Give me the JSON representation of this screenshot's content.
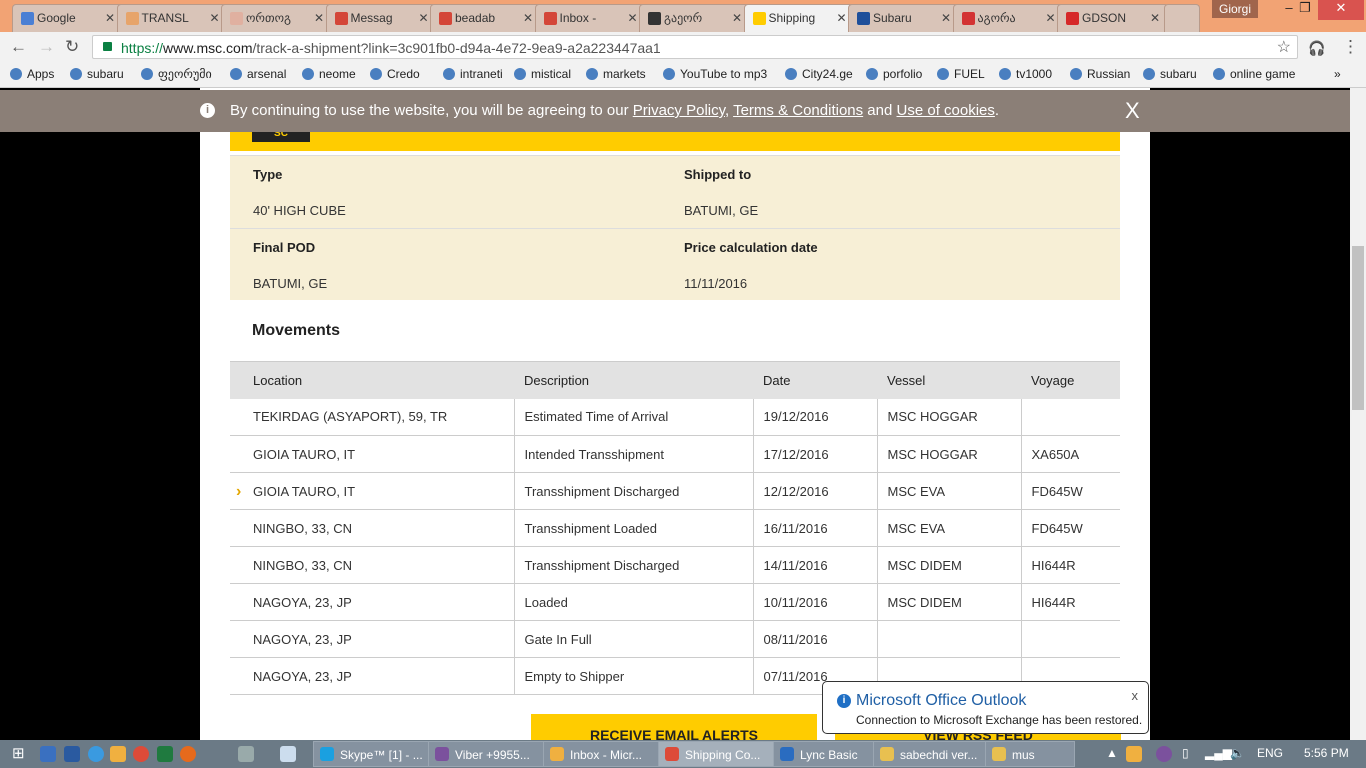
{
  "browser": {
    "tabs": [
      {
        "title": "Google",
        "color": "#4a7fd4"
      },
      {
        "title": "TRANSL",
        "color": "#e7a46a"
      },
      {
        "title": "ორთოგ",
        "color": "#e0b0a0"
      },
      {
        "title": "Messag",
        "color": "#d44638"
      },
      {
        "title": "beadab",
        "color": "#d44638"
      },
      {
        "title": "Inbox -",
        "color": "#d44638"
      },
      {
        "title": "გაეორ",
        "color": "#333333"
      },
      {
        "title": "Shipping",
        "color": "#ffcc00"
      },
      {
        "title": "Subaru",
        "color": "#1f4f9a"
      },
      {
        "title": "აგორა",
        "color": "#d33333"
      },
      {
        "title": "GDSON",
        "color": "#d62828"
      }
    ],
    "close_glyph": "✕",
    "user": "Giorgi",
    "url_prefix": "https://",
    "url_host": "www.msc.com",
    "url_path": "/track-a-shipment?link=3c901fb0-d94a-4e72-9ea9-a2a223447aa1",
    "bookmarks": [
      "Apps",
      "subaru",
      "ფეორუმი",
      "arsenal",
      "neome",
      "Credo",
      "intraneti",
      "mistical",
      "markets",
      "YouTube to mp3",
      "City24.ge",
      "porfolio",
      "FUEL",
      "tv1000",
      "Russian",
      "subaru",
      "online game"
    ],
    "more": "»"
  },
  "cookie": {
    "text": "By continuing to use the website, you will be agreeing to our ",
    "privacy": "Privacy Policy",
    "comma": ", ",
    "terms": "Terms & Conditions",
    "and": " and ",
    "cookies": "Use of cookies",
    "dot": ".",
    "close": "X"
  },
  "logo_text": "SC",
  "details": {
    "type_label": "Type",
    "type_value": "40' HIGH CUBE",
    "shipped_label": "Shipped to",
    "shipped_value": "BATUMI, GE",
    "pod_label": "Final POD",
    "pod_value": "BATUMI, GE",
    "price_label": "Price calculation date",
    "price_value": "11/11/2016"
  },
  "movements": {
    "title": "Movements",
    "columns": [
      "Location",
      "Description",
      "Date",
      "Vessel",
      "Voyage"
    ],
    "rows": [
      [
        "TEKIRDAG (ASYAPORT), 59, TR",
        "Estimated Time of Arrival",
        "19/12/2016",
        "MSC HOGGAR",
        ""
      ],
      [
        "GIOIA TAURO, IT",
        "Intended Transshipment",
        "17/12/2016",
        "MSC HOGGAR",
        "XA650A"
      ],
      [
        "GIOIA TAURO, IT",
        "Transshipment Discharged",
        "12/12/2016",
        "MSC EVA",
        "FD645W"
      ],
      [
        "NINGBO, 33, CN",
        "Transshipment Loaded",
        "16/11/2016",
        "MSC EVA",
        "FD645W"
      ],
      [
        "NINGBO, 33, CN",
        "Transshipment Discharged",
        "14/11/2016",
        "MSC DIDEM",
        "HI644R"
      ],
      [
        "NAGOYA, 23, JP",
        "Loaded",
        "10/11/2016",
        "MSC DIDEM",
        "HI644R"
      ],
      [
        "NAGOYA, 23, JP",
        "Gate In Full",
        "08/11/2016",
        "",
        ""
      ],
      [
        "NAGOYA, 23, JP",
        "Empty to Shipper",
        "07/11/2016",
        "",
        ""
      ]
    ],
    "current_row": 2
  },
  "buttons": {
    "alerts": "RECEIVE EMAIL ALERTS",
    "rss": "VIEW RSS FEED"
  },
  "toast": {
    "title": "Microsoft Office Outlook",
    "message": "Connection to Microsoft Exchange has been restored.",
    "close": "x"
  },
  "taskbar": {
    "items": [
      {
        "label": "Skype™ [1] - ...",
        "color": "#1aa0e0"
      },
      {
        "label": "Viber +9955...",
        "color": "#7b519d"
      },
      {
        "label": "Inbox - Micr...",
        "color": "#f0b040"
      },
      {
        "label": "Shipping Co...",
        "color": "#dd4b39"
      },
      {
        "label": "Lync Basic",
        "color": "#2a6cc0"
      },
      {
        "label": "sabechdi ver...",
        "color": "#e8c050"
      },
      {
        "label": "mus",
        "color": "#e8c050"
      }
    ],
    "lang": "ENG",
    "time": "5:56 PM"
  }
}
